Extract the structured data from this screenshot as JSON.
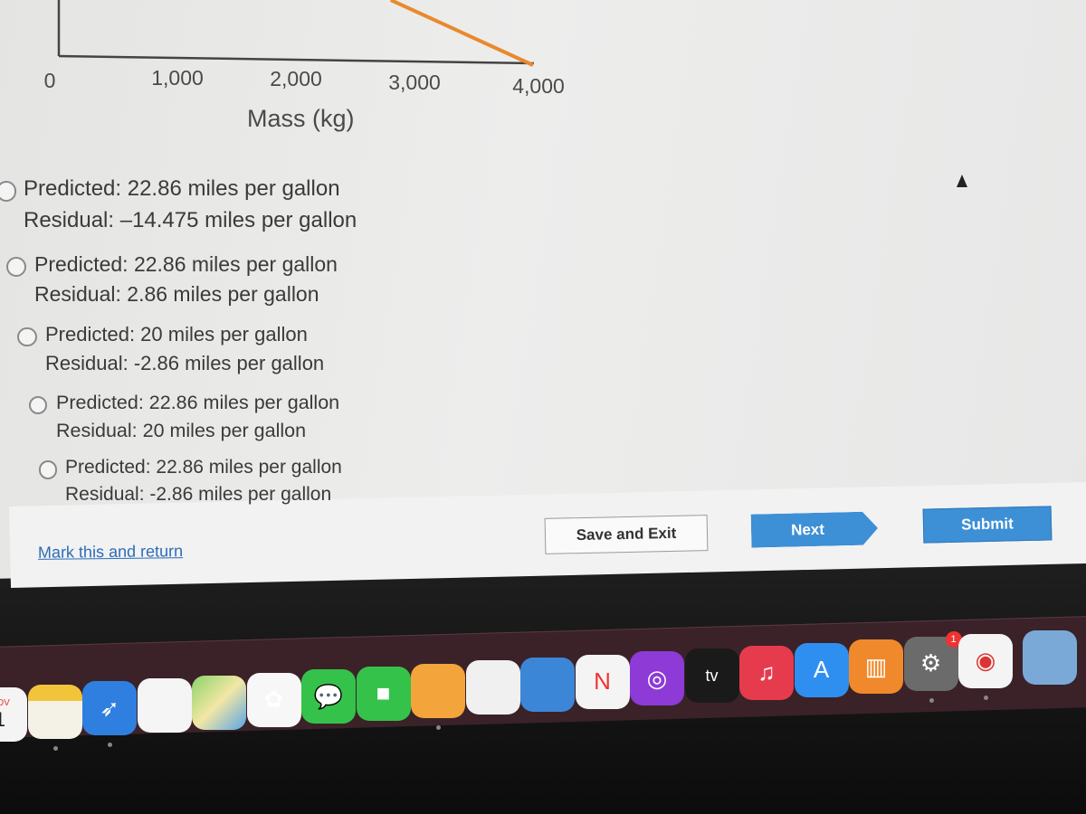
{
  "chart_data": {
    "type": "line",
    "xlabel": "Mass (kg)",
    "x_ticks": [
      "0",
      "1,000",
      "2,000",
      "3,000",
      "4,000"
    ],
    "x_tick_values": [
      0,
      1000,
      2000,
      3000,
      4000
    ],
    "series": [
      {
        "x": [
          2800,
          4000
        ],
        "color": "#e8892c"
      }
    ]
  },
  "options": [
    {
      "predicted": "Predicted: 22.86 miles per gallon",
      "residual": "Residual: –14.475 miles per gallon",
      "selected": false
    },
    {
      "predicted": "Predicted: 22.86 miles per gallon",
      "residual": "Residual: 2.86 miles per gallon",
      "selected": false
    },
    {
      "predicted": "Predicted: 20 miles per gallon",
      "residual": "Residual: -2.86 miles per gallon",
      "selected": false
    },
    {
      "predicted": "Predicted: 22.86 miles per gallon",
      "residual": "Residual: 20 miles per gallon",
      "selected": false
    },
    {
      "predicted": "Predicted: 22.86 miles per gallon",
      "residual": "Residual: -2.86 miles per gallon",
      "selected": false
    }
  ],
  "footer": {
    "mark_link": "Mark this and return",
    "save_exit": "Save and Exit",
    "next": "Next",
    "submit": "Submit",
    "accent": "#3d8fd6"
  },
  "dock": {
    "calendar_month": "NOV",
    "calendar_day": "1",
    "tv_label": "tv",
    "settings_badge": "1",
    "apps": [
      "calendar",
      "notes",
      "safari",
      "reminders",
      "maps",
      "photos",
      "messages",
      "facetime",
      "pages",
      "numbers",
      "keynote",
      "news",
      "podcasts",
      "apple-tv",
      "music",
      "app-store",
      "books",
      "system-preferences",
      "chrome",
      "finder-window"
    ]
  }
}
